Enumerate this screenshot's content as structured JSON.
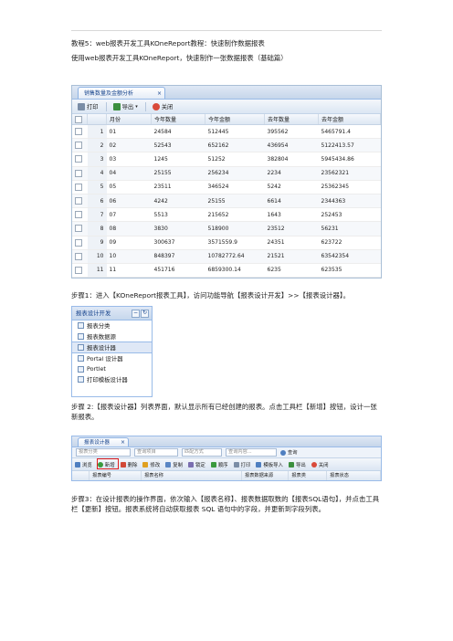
{
  "doc": {
    "title_line": "教程5：web报表开发工具KOneReport教程：快速制作数据报表",
    "intro_line": "使用web报表开发工具KOneReport，快速制作一张数据报表（基础篇）",
    "step1": "步骤1：进入【KOneReport报表工具】，访问功能导航【报表设计开发】>>【报表设计器】。",
    "step2": "步骤 2:【报表设计器】列表界面，默认显示所有已经创建的报表。点击工具栏【新增】按钮，设计一张新报表。",
    "step3": "步骤3：在设计报表的操作界面，依次输入【报表名称】、报表数据取数的【报表SQL语句】，并点击工具栏【更新】按钮。报表系统将自动获取报表 SQL 语句中的字段，并更新到字段列表。"
  },
  "shot1": {
    "tab_title": "销售数量及金额分析",
    "toolbar": {
      "print": "打印",
      "export": "导出",
      "close": "关闭"
    },
    "columns": [
      "月份",
      "今年数量",
      "今年金额",
      "去年数量",
      "去年金额"
    ],
    "rows": [
      [
        "1",
        "01",
        "24584",
        "512445",
        "395562",
        "5465791.4"
      ],
      [
        "2",
        "02",
        "52543",
        "652162",
        "436954",
        "5122413.57"
      ],
      [
        "3",
        "03",
        "1245",
        "51252",
        "382804",
        "5945434.86"
      ],
      [
        "4",
        "04",
        "25155",
        "256234",
        "2234",
        "23562321"
      ],
      [
        "5",
        "05",
        "23511",
        "346524",
        "5242",
        "25362345"
      ],
      [
        "6",
        "06",
        "4242",
        "25155",
        "6614",
        "2344363"
      ],
      [
        "7",
        "07",
        "5513",
        "215652",
        "1643",
        "252453"
      ],
      [
        "8",
        "08",
        "3830",
        "518900",
        "23512",
        "56231"
      ],
      [
        "9",
        "09",
        "300637",
        "3571559.9",
        "24351",
        "623722"
      ],
      [
        "10",
        "10",
        "848397",
        "10782772.64",
        "21521",
        "63542354"
      ],
      [
        "11",
        "11",
        "451716",
        "6859300.14",
        "6235",
        "623535"
      ],
      [
        "12",
        "12",
        "350691",
        "4860847.5",
        "15634",
        "65715"
      ]
    ]
  },
  "shot2": {
    "panel_title": "报表设计开发",
    "items": [
      "报表分类",
      "报表数据源",
      "报表设计器",
      "Portal 设计器",
      "Portlet",
      "打印模板设计器"
    ],
    "selected_index": 2
  },
  "shot3": {
    "tab_title": "报表设计器",
    "search": {
      "category": "报表分类",
      "field": "查询项目",
      "match": "匹配方式",
      "content": "查询内容...",
      "button": "查询"
    },
    "tools": [
      "浏览",
      "新增",
      "删除",
      "修改",
      "复制",
      "锁定",
      "顺序",
      "打印",
      "模板导入",
      "导出",
      "关闭"
    ],
    "headers": [
      "报表编号",
      "报表名称",
      "报表数据来源",
      "报表类",
      "报表状态"
    ]
  }
}
